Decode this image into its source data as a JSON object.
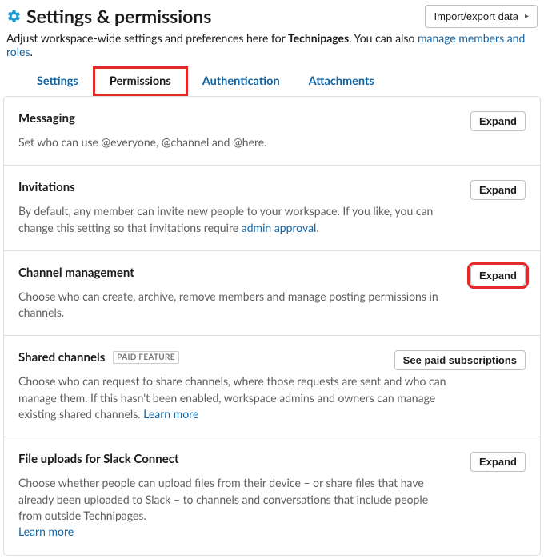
{
  "header": {
    "title": "Settings & permissions",
    "import_label": "Import/export data"
  },
  "subhead": {
    "pre": "Adjust workspace-wide settings and preferences here for ",
    "workspace": "Technipages",
    "post": ". You can also ",
    "link": "manage members and roles",
    "tail": "."
  },
  "tabs": {
    "settings": "Settings",
    "permissions": "Permissions",
    "authentication": "Authentication",
    "attachments": "Attachments"
  },
  "buttons": {
    "expand": "Expand",
    "see_paid": "See paid subscriptions"
  },
  "badge_paid": "PAID FEATURE",
  "sections": {
    "messaging": {
      "title": "Messaging",
      "desc": "Set who can use @everyone, @channel and @here."
    },
    "invitations": {
      "title": "Invitations",
      "desc_pre": "By default, any member can invite new people to your workspace. If you like, you can change this setting so that invitations require ",
      "link": "admin approval",
      "desc_post": "."
    },
    "channel_mgmt": {
      "title": "Channel management",
      "desc": "Choose who can create, archive, remove members and manage posting permissions in channels."
    },
    "shared": {
      "title": "Shared channels",
      "desc_pre": "Choose who can request to share channels, where those requests are sent and who can manage them. If this hasn't been enabled, workspace admins and owners can manage existing shared channels. ",
      "link": "Learn more"
    },
    "file_uploads": {
      "title": "File uploads for Slack Connect",
      "desc_pre": "Choose whether people can upload files from their device – or share files that have already been uploaded to Slack – to channels and conversations that include people from outside ",
      "workspace": "Technipages",
      "desc_post": ". ",
      "link": "Learn more"
    }
  }
}
